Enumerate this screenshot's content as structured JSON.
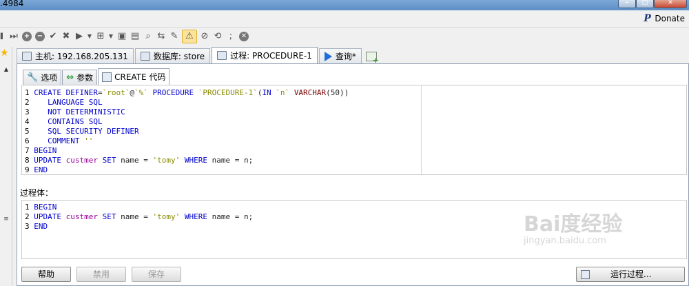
{
  "window": {
    "title": ".4984"
  },
  "donate": {
    "label": "Donate"
  },
  "main_tabs": [
    {
      "label": "主机: 192.168.205.131"
    },
    {
      "label": "数据库: store"
    },
    {
      "label": "过程: PROCEDURE-1"
    },
    {
      "label": "查询*"
    }
  ],
  "sub_tabs": [
    {
      "label": "选项"
    },
    {
      "label": "参数"
    },
    {
      "label": "CREATE 代码"
    }
  ],
  "create_code": [
    {
      "n": "1",
      "text": "CREATE DEFINER=`root`@`%` PROCEDURE `PROCEDURE-1`(IN `n` VARCHAR(50))"
    },
    {
      "n": "2",
      "text": "LANGUAGE SQL"
    },
    {
      "n": "3",
      "text": "NOT DETERMINISTIC"
    },
    {
      "n": "4",
      "text": "CONTAINS SQL"
    },
    {
      "n": "5",
      "text": "SQL SECURITY DEFINER"
    },
    {
      "n": "6",
      "text": "COMMENT ''"
    },
    {
      "n": "7",
      "text": "BEGIN"
    },
    {
      "n": "8",
      "text": "UPDATE custmer SET name = 'tomy' WHERE name = n;"
    },
    {
      "n": "9",
      "text": "END"
    }
  ],
  "body_label": "过程体：",
  "body_code": [
    {
      "n": "1",
      "text": "BEGIN"
    },
    {
      "n": "2",
      "text": "UPDATE custmer SET name = 'tomy' WHERE name = n;"
    },
    {
      "n": "3",
      "text": "END"
    }
  ],
  "buttons": {
    "help": "帮助",
    "disable": "禁用",
    "save": "保存",
    "run": "运行过程..."
  },
  "watermark": {
    "main": "Bai度经验",
    "sub": "jingyan.baidu.com"
  },
  "colors": {
    "keyword": "#0000cc",
    "string": "#888800",
    "identifier": "#990099",
    "type": "#7a0000"
  }
}
